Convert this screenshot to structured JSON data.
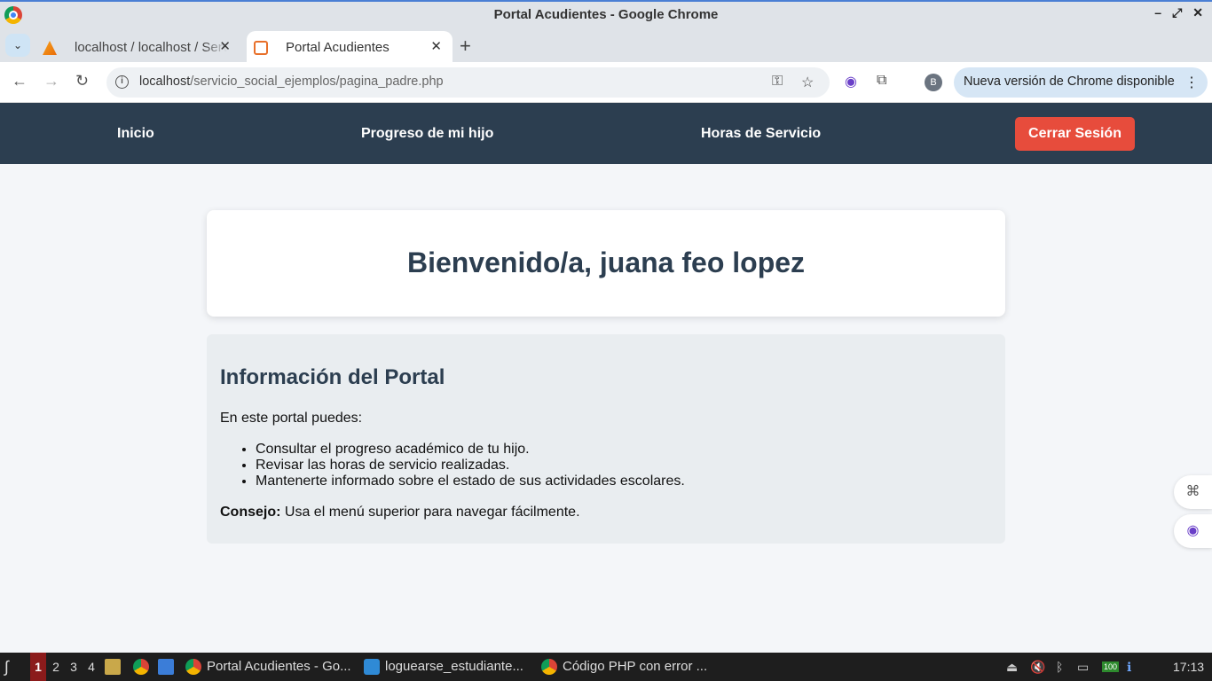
{
  "window": {
    "title": "Portal Acudientes - Google Chrome"
  },
  "tabs": [
    {
      "label": "localhost / localhost / Servicio",
      "active": false,
      "icon": "phpmyadmin-icon"
    },
    {
      "label": "Portal Acudientes",
      "active": true,
      "icon": "xampp-icon"
    }
  ],
  "toolbar": {
    "url_host": "localhost",
    "url_path": "/servicio_social_ejemplos/pagina_padre.php",
    "profile_initial": "B",
    "update_label": "Nueva versión de Chrome disponible"
  },
  "site_nav": {
    "items": [
      "Inicio",
      "Progreso de mi hijo",
      "Horas de Servicio"
    ],
    "logout_label": "Cerrar Sesión",
    "bg_color": "#2c3e50",
    "logout_color": "#e74c3c"
  },
  "welcome": {
    "heading": "Bienvenido/a, juana feo lopez"
  },
  "info": {
    "title": "Información del Portal",
    "intro": "En este portal puedes:",
    "items": [
      "Consultar el progreso académico de tu hijo.",
      "Revisar las horas de servicio realizadas.",
      "Mantenerte informado sobre el estado de sus actividades escolares."
    ],
    "tip_label": "Consejo:",
    "tip_text": " Usa el menú superior para navegar fácilmente."
  },
  "taskbar": {
    "workspaces": [
      "1",
      "2",
      "3",
      "4"
    ],
    "tasks": [
      {
        "label": "Portal Acudientes - Go...",
        "icon": "chrome-icon"
      },
      {
        "label": "loguearse_estudiante...",
        "icon": "vscode-icon"
      },
      {
        "label": "Código PHP con error ...",
        "icon": "chrome-icon"
      }
    ],
    "battery": "100",
    "clock": "17:13"
  }
}
